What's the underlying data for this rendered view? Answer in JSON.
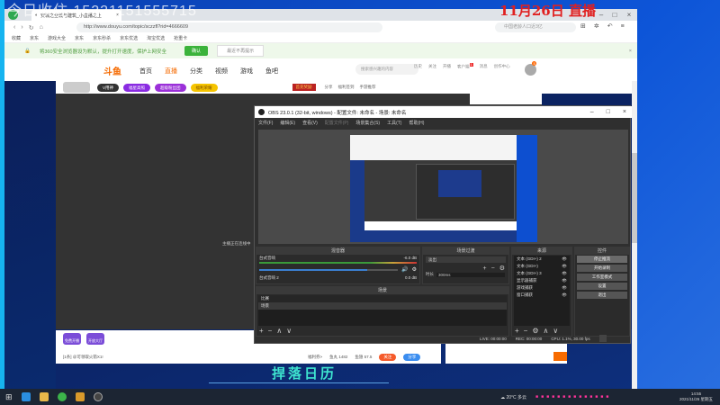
{
  "overlay": {
    "watermark": "今日收住 15221151555715",
    "date_banner": "11月26日 直播"
  },
  "browser": {
    "tab_title": "安城之全城与建筑_小直播之上",
    "url": "http://www.douyu.com/topic/sczzfl?rid=4666609",
    "search_placeholder": "中国老龄人口近3亿",
    "bookmarks": [
      "收藏",
      "京东",
      "游戏大全",
      "京东",
      "京东秒杀",
      "京东优选",
      "淘宝优选",
      "抢重卡"
    ],
    "notice": {
      "text": "将360安全浏览器设为默认，提升打开速度，保护上网安全",
      "confirm": "确认",
      "dismiss": "最近不再提示"
    }
  },
  "douyu": {
    "logo": "斗鱼",
    "nav": [
      "首页",
      "直播",
      "分类",
      "视频",
      "游戏",
      "鱼吧"
    ],
    "search_placeholder": "搜索感兴趣的内容",
    "header_icons": [
      "历史",
      "关注",
      "开播",
      "客户端",
      "消息",
      "创作中心"
    ],
    "message_badge": "1",
    "avatar_badge": "5",
    "pills": [
      {
        "label": "V用神",
        "color": "#333333"
      },
      {
        "label": "福星高照",
        "color": "#8a2be2"
      },
      {
        "label": "超级粉丝团",
        "color": "#9b30d9"
      },
      {
        "label": "福利荣耀",
        "color": "#f5c400"
      }
    ],
    "room_actions": [
      "分享",
      "福利签到",
      "手游推荐"
    ],
    "promo": "首充奖励",
    "player_side_text": "主播正在连线中",
    "bottom": {
      "gift_labels": [
        "免费开播",
        "开放大厅"
      ],
      "chat_hint": "[1条] @可领取火箭X1!",
      "stats": [
        "福利券>",
        "鱼丸 1482",
        "鱼翅 57.5"
      ],
      "follow": "关注",
      "share": "分享",
      "banner": "捍落日历"
    }
  },
  "obs": {
    "title": "OBS 23.0.1 (32-bit, windows) - 配置文件: 未命名 - 场景: 未命名",
    "menu": [
      "文件(F)",
      "编辑(E)",
      "查看(V)",
      "配置文件(P)",
      "场景集合(S)",
      "工具(T)",
      "帮助(H)"
    ],
    "mixer": {
      "title": "混音器",
      "tracks": [
        {
          "name": "台式音响",
          "db": "-6.0 dB",
          "level": 0.78
        },
        {
          "name": "台式音响 2",
          "db": "0.0 dB",
          "level": 0
        }
      ]
    },
    "transitions": {
      "title": "场景过渡",
      "selected": "淡出",
      "duration_label": "时长",
      "duration": "300ms"
    },
    "scenes": {
      "title": "场景",
      "items": [
        "比赛",
        "场景"
      ]
    },
    "sources": {
      "title": "来源",
      "items": [
        "文本 (GDI+) 2",
        "文本 (GDI+)",
        "文本 (GDI+) 3",
        "显示器捕获",
        "游戏捕获",
        "窗口捕获"
      ]
    },
    "controls": {
      "title": "控件",
      "buttons": [
        "停止推流",
        "开始录制",
        "工作室模式",
        "设置",
        "退出"
      ]
    },
    "status": {
      "live": "LIVE: 00:00:00",
      "rec": "REC: 00:00:00",
      "cpu": "CPU: 1.1%, 30.00 fps"
    }
  },
  "taskbar": {
    "weather": "20°C 多云",
    "time": "14:55",
    "date": "2021/11/26 星期五"
  }
}
